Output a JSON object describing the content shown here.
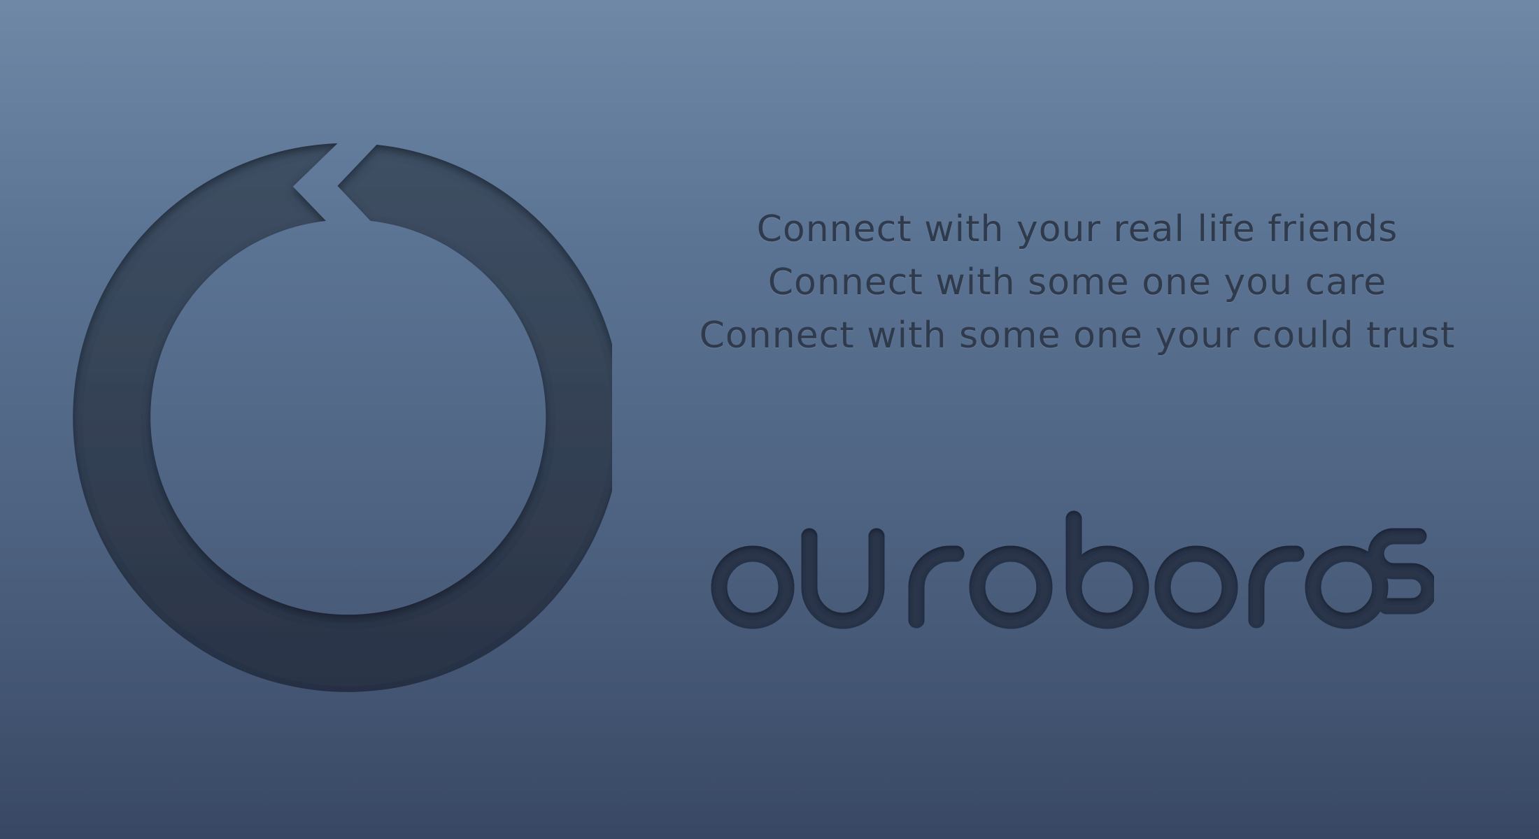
{
  "taglines": [
    "Connect with your real life friends",
    "Connect with some one you care",
    "Connect with some one your could trust"
  ],
  "brand": {
    "wordmark": "ouroboros"
  },
  "colors": {
    "background_top": "#6e88a6",
    "background_bottom": "#384864",
    "ring_top": "#3f5064",
    "ring_bottom": "#2a3346",
    "text": "#2f3a4c"
  },
  "icons": {
    "logo": "ouroboros-ring-icon"
  }
}
